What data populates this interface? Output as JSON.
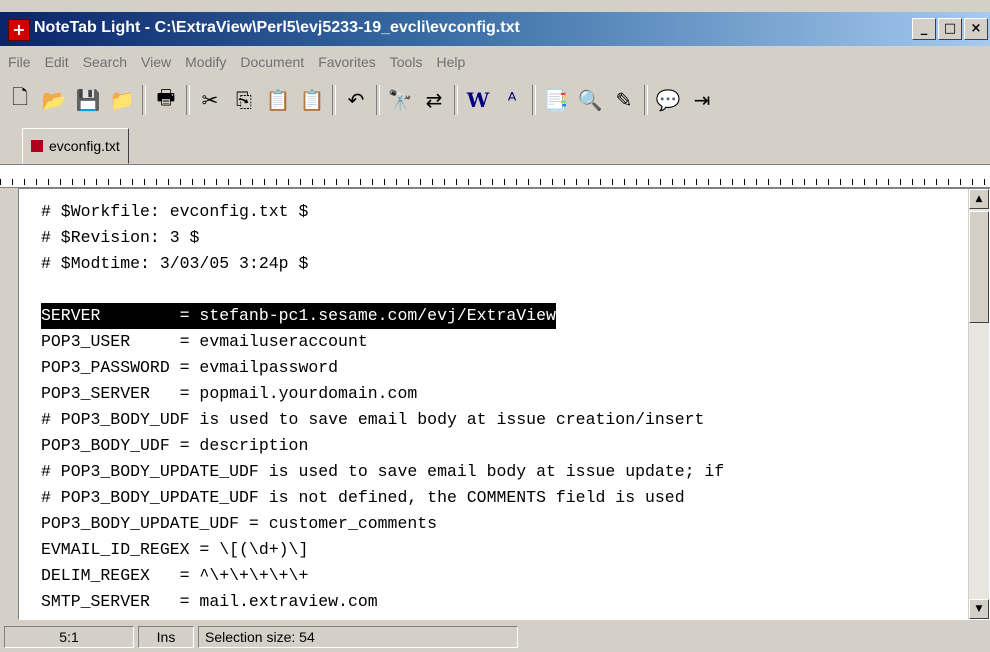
{
  "window": {
    "title": "NoteTab Light - C:\\ExtraView\\Perl5\\evj5233-19_evcli\\evconfig.txt",
    "app_icon_glyph": "+",
    "controls": {
      "minimize": "_",
      "maximize": "□",
      "close": "×"
    }
  },
  "menu": [
    "File",
    "Edit",
    "Search",
    "View",
    "Modify",
    "Document",
    "Favorites",
    "Tools",
    "Help"
  ],
  "toolbar": {
    "icons": [
      {
        "name": "new-file-icon",
        "glyph": "🗋"
      },
      {
        "name": "open-folder-icon",
        "glyph": "📂"
      },
      {
        "name": "save-icon",
        "glyph": "💾"
      },
      {
        "name": "open-file-icon",
        "glyph": "📁"
      },
      {
        "name": "print-icon",
        "glyph": "🖶"
      },
      {
        "name": "cut-icon",
        "glyph": "✂"
      },
      {
        "name": "copy-icon",
        "glyph": "⎘"
      },
      {
        "name": "paste-icon",
        "glyph": "📋"
      },
      {
        "name": "paste-special-icon",
        "glyph": "📋"
      },
      {
        "name": "undo-icon",
        "glyph": "↶"
      },
      {
        "name": "find-icon",
        "glyph": "🔭"
      },
      {
        "name": "replace-icon",
        "glyph": "⇄"
      },
      {
        "name": "word-wrap-icon",
        "glyph": "W"
      },
      {
        "name": "spell-check-icon",
        "glyph": "ᴬ"
      },
      {
        "name": "clipbook-icon",
        "glyph": "📑"
      },
      {
        "name": "browser-view-icon",
        "glyph": "🔍"
      },
      {
        "name": "outline-icon",
        "glyph": "✎"
      },
      {
        "name": "help-icon",
        "glyph": "💬"
      },
      {
        "name": "exit-icon",
        "glyph": "⇥"
      }
    ]
  },
  "tabs": [
    {
      "label": "evconfig.txt"
    }
  ],
  "editor": {
    "lines": [
      "# $Workfile: evconfig.txt $",
      "# $Revision: 3 $",
      "# $Modtime: 3/03/05 3:24p $",
      "",
      "SERVER        = stefanb-pc1.sesame.com/evj/ExtraView",
      "POP3_USER     = evmailuseraccount",
      "POP3_PASSWORD = evmailpassword",
      "POP3_SERVER   = popmail.yourdomain.com",
      "# POP3_BODY_UDF is used to save email body at issue creation/insert",
      "POP3_BODY_UDF = description",
      "# POP3_BODY_UPDATE_UDF is used to save email body at issue update; if",
      "# POP3_BODY_UPDATE_UDF is not defined, the COMMENTS field is used",
      "POP3_BODY_UPDATE_UDF = customer_comments",
      "EVMAIL_ID_REGEX = \\[(\\d+)\\]",
      "DELIM_REGEX   = ^\\+\\+\\+\\+\\+",
      "SMTP_SERVER   = mail.extraview.com"
    ],
    "selected_line": 4
  },
  "status": {
    "position": "5:1",
    "mode": "Ins",
    "selection": "Selection size: 54"
  }
}
